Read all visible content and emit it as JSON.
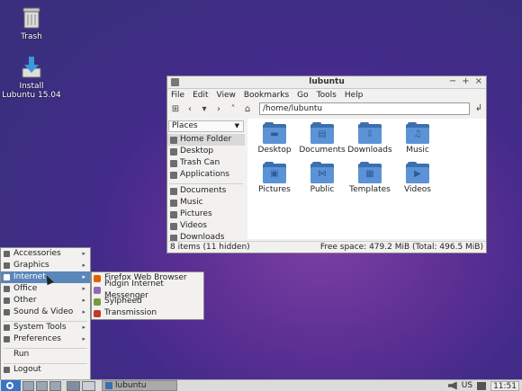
{
  "desktop": {
    "icons": [
      {
        "label": "Trash"
      },
      {
        "label": "Install\nLubuntu 15.04"
      }
    ]
  },
  "window": {
    "title": "lubuntu",
    "controls": {
      "minimize": "−",
      "maximize": "+",
      "close": "×"
    },
    "menubar": [
      "File",
      "Edit",
      "View",
      "Bookmarks",
      "Go",
      "Tools",
      "Help"
    ],
    "path": "/home/lubuntu",
    "sidebar": {
      "header": "Places",
      "items": [
        {
          "label": "Home Folder",
          "icon": "home-icon",
          "selected": true
        },
        {
          "label": "Desktop",
          "icon": "desktop-icon"
        },
        {
          "label": "Trash Can",
          "icon": "trash-icon"
        },
        {
          "label": "Applications",
          "icon": "applications-icon"
        }
      ],
      "bookmarks": [
        {
          "label": "Documents",
          "icon": "documents-icon"
        },
        {
          "label": "Music",
          "icon": "music-icon"
        },
        {
          "label": "Pictures",
          "icon": "pictures-icon"
        },
        {
          "label": "Videos",
          "icon": "videos-icon"
        },
        {
          "label": "Downloads",
          "icon": "downloads-icon"
        }
      ]
    },
    "files": [
      {
        "name": "Desktop",
        "icon": "desktop-folder-icon",
        "glyph": "▬"
      },
      {
        "name": "Documents",
        "icon": "documents-folder-icon",
        "glyph": "▤"
      },
      {
        "name": "Downloads",
        "icon": "downloads-folder-icon",
        "glyph": "⇩"
      },
      {
        "name": "Music",
        "icon": "music-folder-icon",
        "glyph": "♫"
      },
      {
        "name": "Pictures",
        "icon": "pictures-folder-icon",
        "glyph": "▣"
      },
      {
        "name": "Public",
        "icon": "public-folder-icon",
        "glyph": "⋈"
      },
      {
        "name": "Templates",
        "icon": "templates-folder-icon",
        "glyph": "▦"
      },
      {
        "name": "Videos",
        "icon": "videos-folder-icon",
        "glyph": "▶"
      }
    ],
    "status": {
      "items": "8 items (11 hidden)",
      "free": "Free space: 479.2 MiB (Total: 496.5 MiB)"
    }
  },
  "start_menu": {
    "items": [
      {
        "label": "Accessories",
        "submenu": true
      },
      {
        "label": "Graphics",
        "submenu": true
      },
      {
        "label": "Internet",
        "submenu": true,
        "highlighted": true
      },
      {
        "label": "Office",
        "submenu": true
      },
      {
        "label": "Other",
        "submenu": true
      },
      {
        "label": "Sound & Video",
        "submenu": true
      }
    ],
    "items2": [
      {
        "label": "System Tools",
        "submenu": true
      },
      {
        "label": "Preferences",
        "submenu": true
      }
    ],
    "run": "Run",
    "logout": "Logout",
    "submenu": [
      {
        "label": "Firefox Web Browser",
        "color": "#e66000"
      },
      {
        "label": "Pidgin Internet Messenger",
        "color": "#8e6bb5"
      },
      {
        "label": "Sylpheed",
        "color": "#7a9a3a"
      },
      {
        "label": "Transmission",
        "color": "#c0392b"
      }
    ]
  },
  "panel": {
    "task_label": "lubuntu",
    "keyboard": "US",
    "clock": "11:51"
  }
}
